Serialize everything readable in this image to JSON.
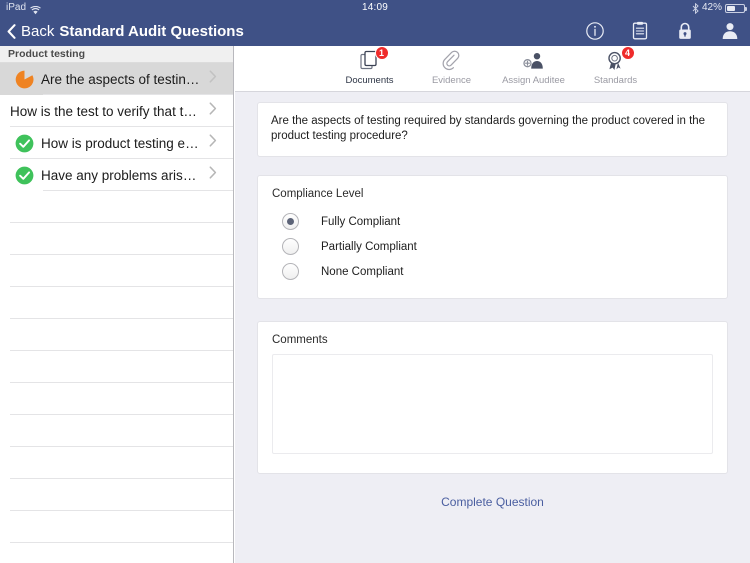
{
  "status_bar": {
    "device": "iPad",
    "wifi_icon": "wifi-icon",
    "time": "14:09",
    "bluetooth_icon": "bluetooth-icon",
    "battery_percent": "42%",
    "battery_icon": "battery-icon"
  },
  "navbar": {
    "back_icon": "chevron-left-icon",
    "back_label": "Back",
    "title": "Standard Audit Questions",
    "actions": [
      {
        "name": "info-icon",
        "label": "Info"
      },
      {
        "name": "clipboard-icon",
        "label": "Audit Checklist"
      },
      {
        "name": "lock-icon",
        "label": "Lock"
      },
      {
        "name": "user-icon",
        "label": "User"
      }
    ],
    "background_color": "#3f5186"
  },
  "sidebar": {
    "section_header": "Product testing",
    "items": [
      {
        "label": "Are the aspects of  testing...",
        "status_icon": "pie-progress-icon",
        "status_color": "#ef8322",
        "selected": true,
        "chevron_icon": "chevron-right-icon"
      },
      {
        "label": "How is the test to verify that the...",
        "status_icon": "",
        "status_color": "",
        "selected": false,
        "chevron_icon": "chevron-right-icon"
      },
      {
        "label": "How is product testing evi...",
        "status_icon": "check-circle-icon",
        "status_color": "#3fc25b",
        "selected": false,
        "chevron_icon": "chevron-right-icon"
      },
      {
        "label": "Have any problems arisen f...",
        "status_icon": "check-circle-icon",
        "status_color": "#3fc25b",
        "selected": false,
        "chevron_icon": "chevron-right-icon"
      }
    ],
    "empty_row_count": 11
  },
  "tabs": [
    {
      "label": "Documents",
      "icon": "documents-icon",
      "badge": "1",
      "active": true
    },
    {
      "label": "Evidence",
      "icon": "paperclip-icon",
      "badge": "",
      "active": false
    },
    {
      "label": "Assign Auditee",
      "icon": "assign-auditee-icon",
      "badge": "",
      "active": false
    },
    {
      "label": "Standards",
      "icon": "award-ribbon-icon",
      "badge": "4",
      "active": false
    }
  ],
  "question": {
    "text": "Are the aspects of  testing required by standards governing the product covered in the product testing procedure?"
  },
  "compliance": {
    "title": "Compliance Level",
    "options": [
      {
        "label": "Fully Compliant",
        "selected": true
      },
      {
        "label": "Partially Compliant",
        "selected": false
      },
      {
        "label": "None Compliant",
        "selected": false
      }
    ]
  },
  "comments": {
    "title": "Comments",
    "value": "",
    "placeholder": ""
  },
  "footer": {
    "complete_label": "Complete Question",
    "link_color": "#4a5ea0"
  },
  "theme": {
    "navbar": "#3f5186",
    "content_bg": "#eeeef4",
    "badge_red": "#ef2b2b",
    "check_green": "#3fc25b",
    "progress_orange": "#ef8322"
  }
}
